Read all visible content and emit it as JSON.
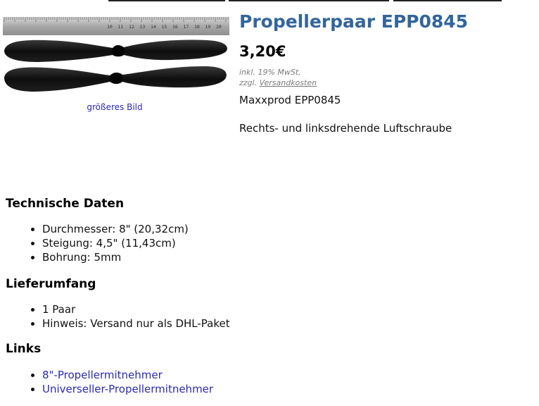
{
  "product": {
    "title": "Propellerpaar EPP0845",
    "price": "3,20€",
    "tax_note": "inkl. 19% MwSt,",
    "shipping_prefix": "zzgl.",
    "shipping_link": "Versandkosten",
    "manufacturer": "Maxxprod EPP0845",
    "description": "Rechts- und linksdrehende Luftschraube",
    "enlarge_link": "größeres Bild"
  },
  "image": {
    "icon": "propeller-pair-photo",
    "ruler_labels": [
      "10",
      "11",
      "12",
      "13",
      "14",
      "15",
      "16",
      "17",
      "18",
      "19",
      "20"
    ]
  },
  "sections": {
    "tech": {
      "title": "Technische Daten",
      "items": [
        "Durchmesser: 8\" (20,32cm)",
        "Steigung: 4,5\" (11,43cm)",
        "Bohrung: 5mm"
      ]
    },
    "scope": {
      "title": "Lieferumfang",
      "items": [
        "1 Paar",
        "Hinweis: Versand nur als DHL-Paket"
      ]
    },
    "links": {
      "title": "Links",
      "items": [
        "8\"-Propellermitnehmer",
        "Universeller-Propellermitnehmer"
      ]
    }
  },
  "colors": {
    "title": "#33659a",
    "link": "#2a2ab4",
    "muted": "#7a7a7a"
  }
}
